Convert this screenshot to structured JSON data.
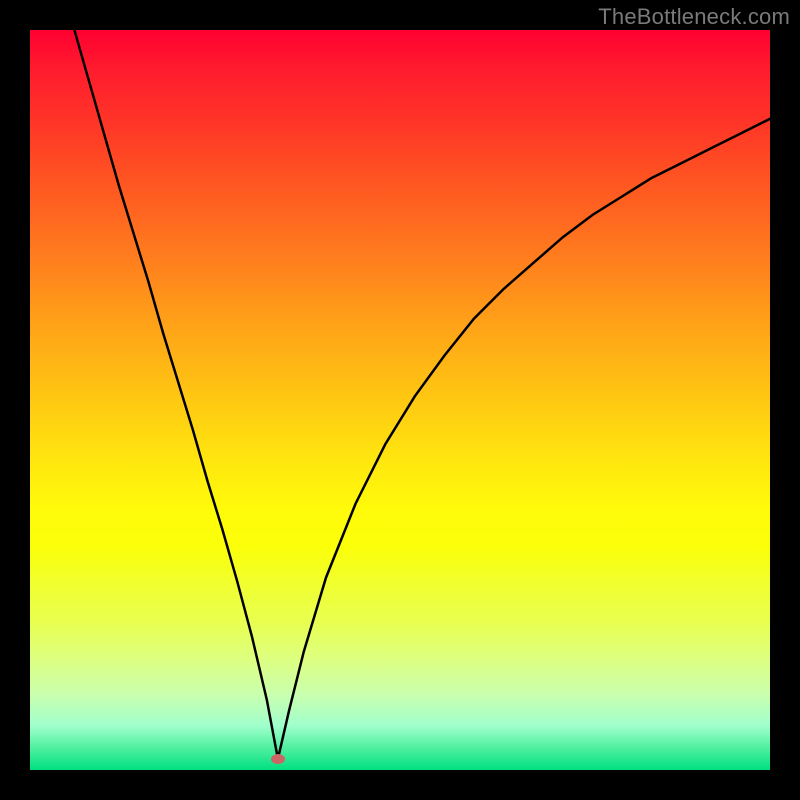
{
  "watermark": "TheBottleneck.com",
  "marker": {
    "x_fraction": 0.335,
    "y_fraction": 0.985
  },
  "chart_data": {
    "type": "line",
    "title": "",
    "xlabel": "",
    "ylabel": "",
    "xlim": [
      0,
      100
    ],
    "ylim": [
      0,
      100
    ],
    "series": [
      {
        "name": "bottleneck-curve",
        "x": [
          6,
          8,
          10,
          12,
          14,
          16,
          18,
          20,
          22,
          24,
          26,
          28,
          30,
          32,
          33.5,
          35,
          37,
          40,
          44,
          48,
          52,
          56,
          60,
          64,
          68,
          72,
          76,
          80,
          84,
          88,
          92,
          96,
          100
        ],
        "values": [
          100,
          93,
          86,
          79,
          72.5,
          66,
          59,
          52.5,
          46,
          39,
          32.5,
          25.5,
          18,
          9.5,
          1.5,
          8,
          16,
          26,
          36,
          44,
          50.5,
          56,
          61,
          65,
          68.5,
          72,
          75,
          77.5,
          80,
          82,
          84,
          86,
          88
        ]
      }
    ],
    "marker_points": [
      {
        "name": "optimal-point",
        "x": 33.5,
        "y": 1.5
      }
    ],
    "background_gradient": {
      "top": "#ff0030",
      "bottom": "#00e080",
      "stops": [
        "red",
        "orange",
        "yellow",
        "green"
      ]
    }
  }
}
